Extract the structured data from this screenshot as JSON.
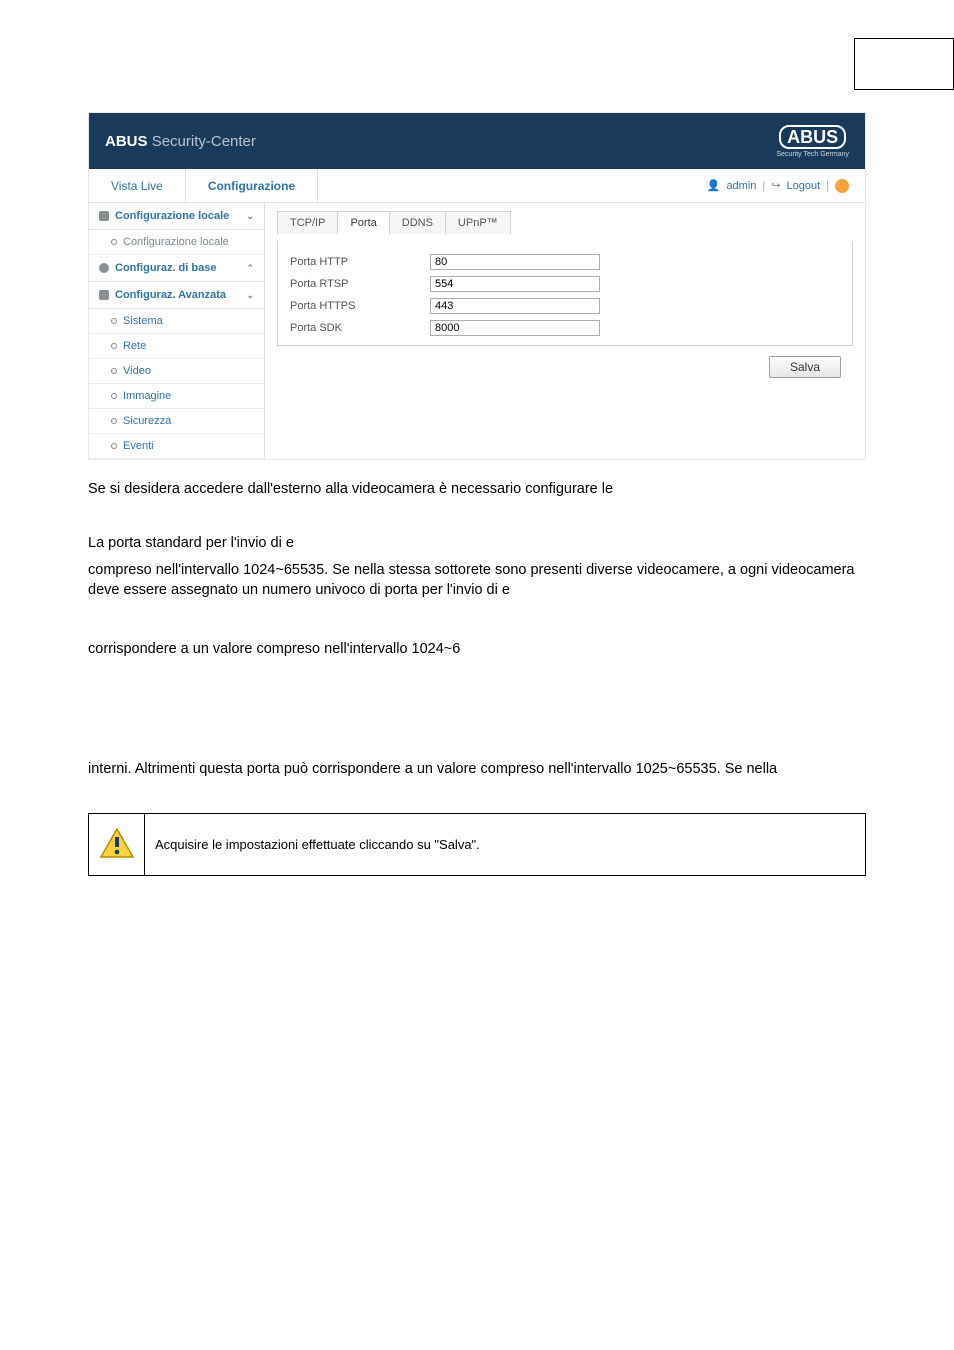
{
  "header": {
    "brand_main": "ABUS",
    "brand_sub": "Security-Center",
    "logo_text": "ABUS",
    "logo_tag": "Security Tech Germany"
  },
  "topnav": {
    "tab_live": "Vista Live",
    "tab_config": "Configurazione"
  },
  "usermeta": {
    "user_label": "admin",
    "logout_label": "Logout"
  },
  "sidebar": {
    "group_local": "Configurazione locale",
    "item_local": "Configurazione locale",
    "group_base": "Configuraz. di base",
    "group_adv": "Configuraz. Avanzata",
    "items_adv": {
      "sistema": "Sistema",
      "rete": "Rete",
      "video": "Video",
      "immagine": "Immagine",
      "sicurezza": "Sicurezza",
      "eventi": "Eventi"
    }
  },
  "panel_tabs": {
    "tcpip": "TCP/IP",
    "porta": "Porta",
    "ddns": "DDNS",
    "upnp": "UPnP™"
  },
  "form": {
    "http": {
      "label": "Porta HTTP",
      "value": "80"
    },
    "rtsp": {
      "label": "Porta RTSP",
      "value": "554"
    },
    "https": {
      "label": "Porta HTTPS",
      "value": "443"
    },
    "sdk": {
      "label": "Porta SDK",
      "value": "8000"
    }
  },
  "buttons": {
    "save": "Salva"
  },
  "doc": {
    "p1": "Se si desidera accedere dall'esterno alla videocamera è necessario configurare le",
    "p2a": "La porta standard per l'invio di e",
    "p2b": "compreso nell'intervallo 1024~65535. Se nella stessa sottorete sono presenti diverse videocamere, a ogni videocamera deve essere assegnato un numero univoco di porta per l'invio di e",
    "p3": "corrispondere a un valore compreso nell'intervallo 1024~6",
    "p4": "interni. Altrimenti questa porta può corrispondere a un valore compreso nell'intervallo 1025~65535. Se nella",
    "note": "Acquisire le impostazioni effettuate cliccando su \"Salva\"."
  }
}
